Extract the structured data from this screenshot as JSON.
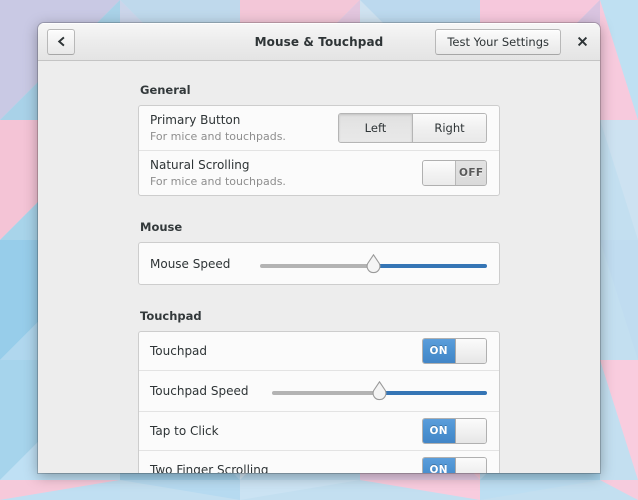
{
  "window": {
    "title": "Mouse & Touchpad",
    "back_icon": "chevron-left-icon",
    "close_icon": "close-icon",
    "test_button_label": "Test Your Settings"
  },
  "theme": {
    "accent_blue": "#4a90d0",
    "slider_fill": "#3575b5",
    "window_bg": "#ededed",
    "panel_bg": "#fbfbfb",
    "text": "#2e3436",
    "subtext": "#8e8e8e"
  },
  "sections": [
    {
      "title": "General",
      "rows": [
        {
          "title": "Primary Button",
          "subtitle": "For mice and touchpads.",
          "control": "segmented",
          "options": [
            "Left",
            "Right"
          ],
          "selected": "Left"
        },
        {
          "title": "Natural Scrolling",
          "subtitle": "For mice and touchpads.",
          "control": "switch",
          "state": "OFF"
        }
      ]
    },
    {
      "title": "Mouse",
      "rows": [
        {
          "title": "Mouse Speed",
          "subtitle": "",
          "control": "slider",
          "value_percent": 50
        }
      ]
    },
    {
      "title": "Touchpad",
      "rows": [
        {
          "title": "Touchpad",
          "subtitle": "",
          "control": "switch",
          "state": "ON"
        },
        {
          "title": "Touchpad Speed",
          "subtitle": "",
          "control": "slider",
          "value_percent": 50
        },
        {
          "title": "Tap to Click",
          "subtitle": "",
          "control": "switch",
          "state": "ON"
        },
        {
          "title": "Two Finger Scrolling",
          "subtitle": "",
          "control": "switch",
          "state": "ON"
        }
      ]
    }
  ]
}
